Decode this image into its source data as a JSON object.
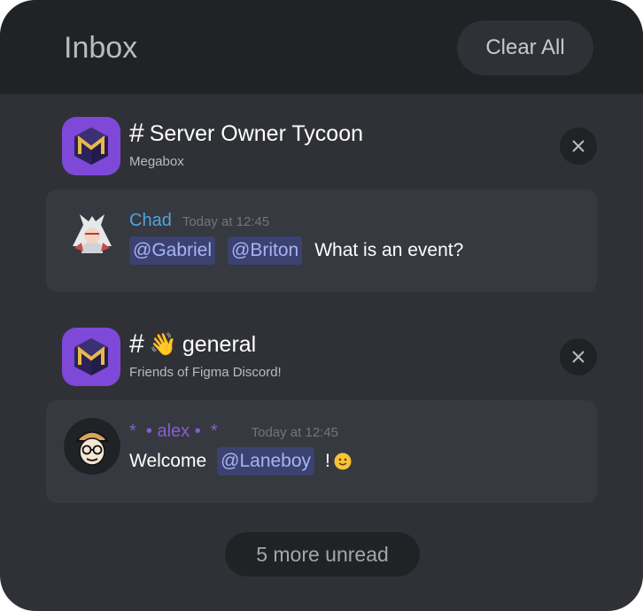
{
  "header": {
    "title": "Inbox",
    "clear_label": "Clear All"
  },
  "threads": [
    {
      "hash": "#",
      "emoji": "",
      "channel": "Server Owner Tycoon",
      "server": "Megabox",
      "message": {
        "author": "Chad",
        "author_color": "#4fa3e0",
        "time": "Today at 12:45",
        "mentions": [
          "@Gabriel",
          "@Briton"
        ],
        "text": "What is an event?"
      }
    },
    {
      "hash": "#",
      "emoji": "👋",
      "channel": "general",
      "server": "Friends of Figma Discord!",
      "message": {
        "author": "*  • alex •  *",
        "author_color": "#8a5cd0",
        "time": "Today at 12:45",
        "text_before": "Welcome",
        "mention": "@Laneboy",
        "text_after": "!"
      }
    }
  ],
  "footer": {
    "more_label": "5 more unread"
  },
  "colors": {
    "panel": "#2f3136",
    "header": "#202225",
    "card": "#36393f",
    "mention_bg": "#3c4270",
    "mention_text": "#a6b4f5",
    "server_icon": "#7e49d8"
  }
}
